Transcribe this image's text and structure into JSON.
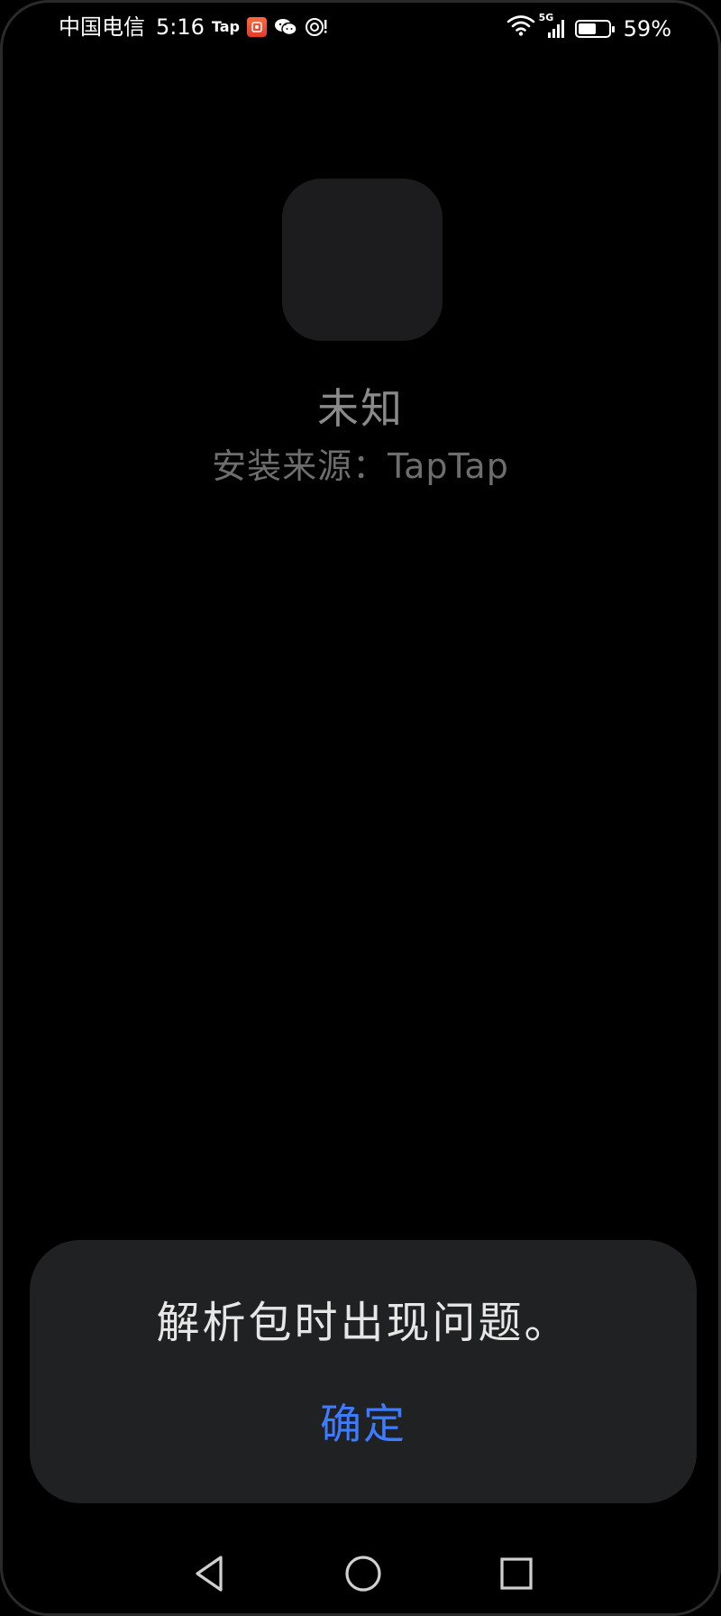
{
  "status_bar": {
    "carrier": "中国电信",
    "time": "5:16",
    "notification_icons": [
      "tap-app-icon",
      "red-app-icon",
      "wechat-icon",
      "at-icon"
    ],
    "tap_label": "Tap",
    "network_label": "5G",
    "battery_percent_text": "59%",
    "battery_level": 0.59
  },
  "app_info": {
    "name": "未知",
    "install_source": "安装来源：TapTap"
  },
  "dialog": {
    "message": "解析包时出现问题。",
    "confirm_label": "确定",
    "confirm_color": "#3d7bff"
  },
  "nav_bar": {
    "icons": [
      "back-icon",
      "home-icon",
      "recent-apps-icon"
    ]
  }
}
